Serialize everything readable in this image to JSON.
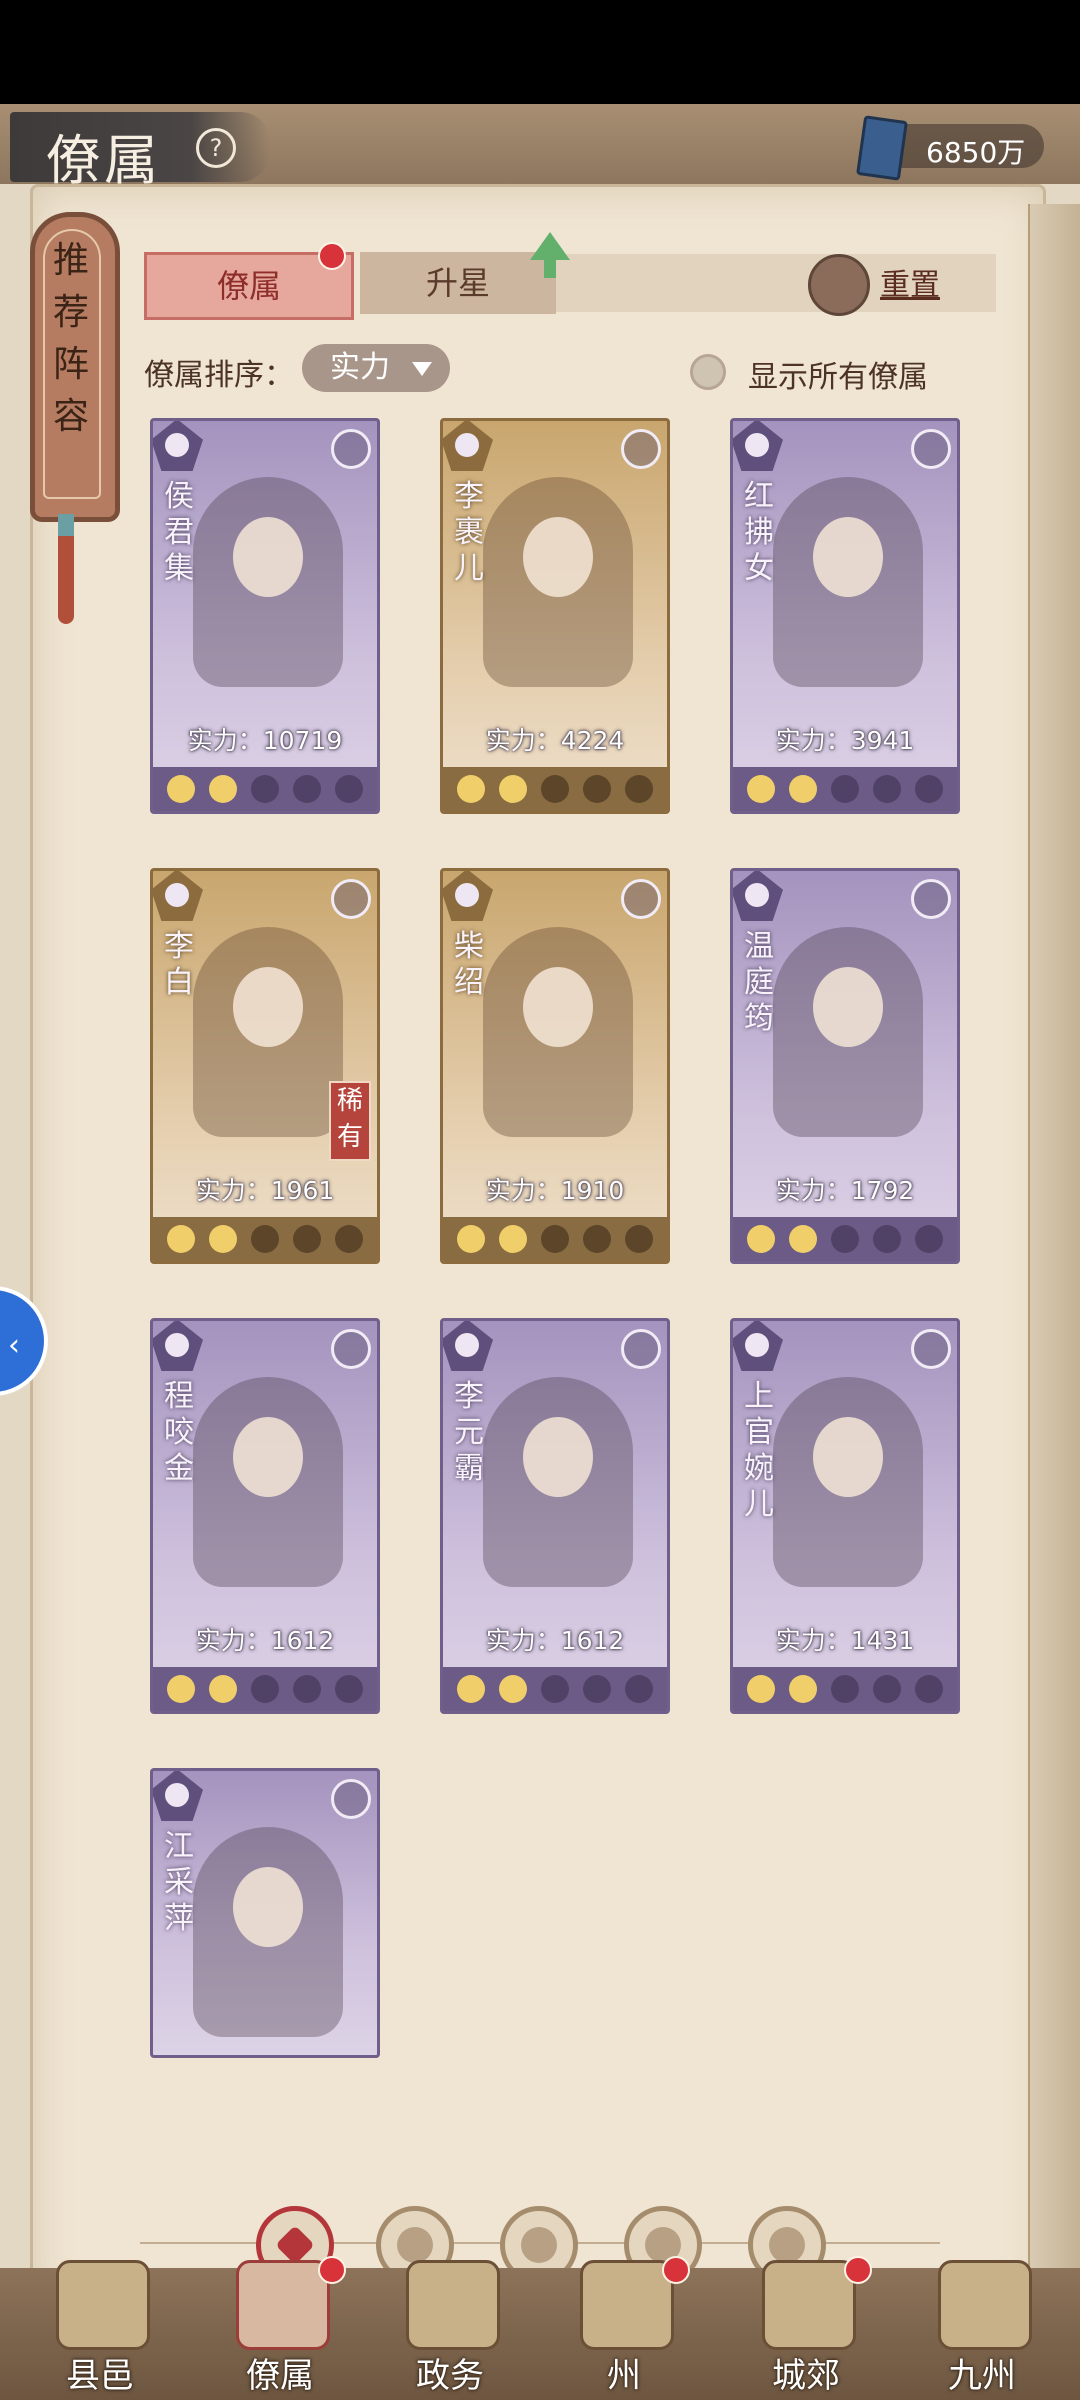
{
  "header": {
    "title": "僚属",
    "help_icon": "question-circle-icon",
    "currency_icon": "book-icon",
    "currency_value": "6850万"
  },
  "side_banner": {
    "label": "推荐阵容"
  },
  "tabs": [
    {
      "label": "僚属",
      "active": true,
      "badge": true
    },
    {
      "label": "升星",
      "active": false,
      "badge": false,
      "upgrade_arrow": true
    }
  ],
  "reset": {
    "label": "重置",
    "icon": "reset-icon"
  },
  "sort": {
    "label": "僚属排序：",
    "selected": "实力"
  },
  "show_all": {
    "label": "显示所有僚属",
    "checked": false
  },
  "cards": [
    {
      "name": "侯君集",
      "power": "实力：10719",
      "stars": 2,
      "theme": "purple",
      "rare": ""
    },
    {
      "name": "李裹儿",
      "power": "实力：4224",
      "stars": 2,
      "theme": "gold",
      "rare": ""
    },
    {
      "name": "红拂女",
      "power": "实力：3941",
      "stars": 2,
      "theme": "purple",
      "rare": ""
    },
    {
      "name": "李白",
      "power": "实力：1961",
      "stars": 2,
      "theme": "gold",
      "rare": "稀有"
    },
    {
      "name": "柴绍",
      "power": "实力：1910",
      "stars": 2,
      "theme": "gold",
      "rare": ""
    },
    {
      "name": "温庭筠",
      "power": "实力：1792",
      "stars": 2,
      "theme": "purple",
      "rare": ""
    },
    {
      "name": "程咬金",
      "power": "实力：1612",
      "stars": 2,
      "theme": "purple",
      "rare": ""
    },
    {
      "name": "李元霸",
      "power": "实力：1612",
      "stars": 2,
      "theme": "purple",
      "rare": ""
    },
    {
      "name": "上官婉儿",
      "power": "实力：1431",
      "stars": 2,
      "theme": "purple",
      "rare": ""
    },
    {
      "name": "江采萍",
      "power": "",
      "stars": 0,
      "theme": "purple",
      "rare": ""
    }
  ],
  "filters": [
    {
      "icon": "all-diamond-icon",
      "active": true
    },
    {
      "icon": "helmet-icon",
      "active": false
    },
    {
      "icon": "gourd-icon",
      "active": false
    },
    {
      "icon": "fan-icon",
      "active": false
    },
    {
      "icon": "mountain-icon",
      "active": false
    }
  ],
  "bottom_nav": [
    {
      "label": "县邑",
      "badge": false,
      "active": false
    },
    {
      "label": "僚属",
      "badge": true,
      "active": true
    },
    {
      "label": "政务",
      "badge": false,
      "active": false
    },
    {
      "label": "州",
      "badge": true,
      "active": false
    },
    {
      "label": "城郊",
      "badge": true,
      "active": false
    },
    {
      "label": "九州",
      "badge": false,
      "active": false
    }
  ],
  "colors": {
    "accent_red": "#d8323a",
    "card_purple": "#a493be",
    "card_gold": "#c9a66e",
    "paper": "#efe5d2"
  }
}
